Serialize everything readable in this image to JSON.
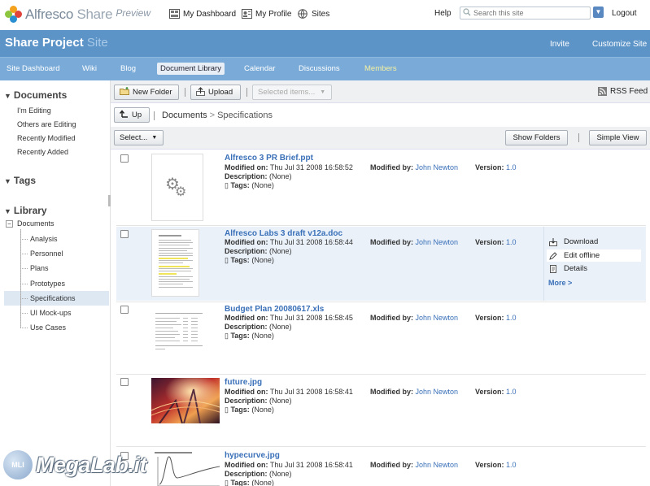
{
  "header": {
    "logo_brand": "Alfresco",
    "logo_product": "Share",
    "logo_tag": "Preview",
    "nav": [
      {
        "label": "My Dashboard",
        "icon": "dashboard-icon"
      },
      {
        "label": "My Profile",
        "icon": "profile-icon"
      },
      {
        "label": "Sites",
        "icon": "sites-icon"
      }
    ],
    "help": "Help",
    "search_placeholder": "Search this site",
    "logout": "Logout"
  },
  "site": {
    "title": "Share Project",
    "title_suffix": "Site",
    "invite": "Invite",
    "customize": "Customize Site"
  },
  "site_nav": [
    {
      "label": "Site Dashboard"
    },
    {
      "label": "Wiki"
    },
    {
      "label": "Blog"
    },
    {
      "label": "Document Library",
      "active": true
    },
    {
      "label": "Calendar"
    },
    {
      "label": "Discussions"
    },
    {
      "label": "Members"
    }
  ],
  "sidebar": {
    "documents_heading": "Documents",
    "document_filters": [
      "I'm Editing",
      "Others are Editing",
      "Recently Modified",
      "Recently Added"
    ],
    "tags_heading": "Tags",
    "library_heading": "Library",
    "tree_root": "Documents",
    "tree_minus": "−",
    "folders": [
      "Analysis",
      "Personnel",
      "Plans",
      "Prototypes",
      "Specifications",
      "UI Mock-ups",
      "Use Cases"
    ],
    "selected_folder": "Specifications"
  },
  "toolbar": {
    "new_folder": "New Folder",
    "upload": "Upload",
    "selected_items": "Selected items...",
    "rss_feed": "RSS Feed"
  },
  "breadcrumb": {
    "up": "Up",
    "root": "Documents",
    "separator": ">",
    "current": "Specifications"
  },
  "options": {
    "select": "Select...",
    "show_folders": "Show Folders",
    "simple_view": "Simple View"
  },
  "labels": {
    "modified_on": "Modified on:",
    "description": "Description:",
    "tags": "Tags:",
    "modified_by": "Modified by:",
    "version": "Version:"
  },
  "documents": [
    {
      "name": "Alfresco 3 PR Brief.ppt",
      "modified_on": "Thu Jul 31 2008 16:58:52",
      "description": "(None)",
      "tags": "(None)",
      "modified_by": "John Newton",
      "version": "1.0"
    },
    {
      "name": "Alfresco Labs 3 draft v12a.doc",
      "modified_on": "Thu Jul 31 2008 16:58:44",
      "description": "(None)",
      "tags": "(None)",
      "modified_by": "John Newton",
      "version": "1.0"
    },
    {
      "name": "Budget Plan 20080617.xls",
      "modified_on": "Thu Jul 31 2008 16:58:45",
      "description": "(None)",
      "tags": "(None)",
      "modified_by": "John Newton",
      "version": "1.0"
    },
    {
      "name": "future.jpg",
      "modified_on": "Thu Jul 31 2008 16:58:41",
      "description": "(None)",
      "tags": "(None)",
      "modified_by": "John Newton",
      "version": "1.0"
    },
    {
      "name": "hypecurve.jpg",
      "modified_on": "Thu Jul 31 2008 16:58:41",
      "description": "(None)",
      "tags": "(None)",
      "modified_by": "John Newton",
      "version": "1.0"
    }
  ],
  "actions": {
    "download": "Download",
    "edit_offline": "Edit offline",
    "details": "Details",
    "more": "More >"
  },
  "watermark": {
    "badge": "MLI",
    "text": "MegaLab.it"
  },
  "colors": {
    "title_bar": "#5c94c8",
    "site_nav": "#7aabd8",
    "link": "#3a70b8",
    "selected_row": "#eaf1f9"
  }
}
